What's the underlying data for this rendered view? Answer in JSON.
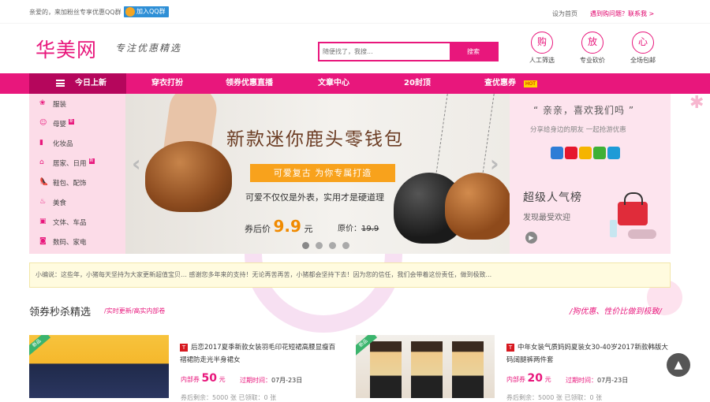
{
  "topbar": {
    "welcome": "亲爱的，来加粉丝专享优惠QQ群",
    "qq_button": "加入QQ群",
    "set_home": "设为首页",
    "contact": "遇到购问题？联系我 >"
  },
  "header": {
    "logo": "华美网",
    "slogan": "专注优惠精选",
    "search_placeholder": "随便找了，我搜...",
    "search_button": "搜索",
    "features": [
      {
        "icon": "购",
        "label": "人工筛选"
      },
      {
        "icon": "放",
        "label": "专业砍价"
      },
      {
        "icon": "心",
        "label": "全场包邮"
      }
    ]
  },
  "nav": {
    "items": [
      "今日上新",
      "穿衣打扮",
      "领券优惠直播",
      "文章中心",
      "20封顶",
      "查优惠券"
    ],
    "hot_badge": "HOT"
  },
  "sidebar": {
    "items": [
      {
        "label": "服装",
        "icon": "dress-icon",
        "glyph": "❀"
      },
      {
        "label": "母婴",
        "icon": "baby-icon",
        "glyph": "☺",
        "tag": "新"
      },
      {
        "label": "化妆品",
        "icon": "lipstick-icon",
        "glyph": "▮"
      },
      {
        "label": "居家、日用",
        "icon": "home-icon",
        "glyph": "⌂",
        "tag": "新"
      },
      {
        "label": "鞋包、配饰",
        "icon": "shoe-icon",
        "glyph": "👠"
      },
      {
        "label": "美食",
        "icon": "food-icon",
        "glyph": "♨"
      },
      {
        "label": "文体、车品",
        "icon": "car-icon",
        "glyph": "▣"
      },
      {
        "label": "数码、家电",
        "icon": "camera-icon",
        "glyph": "◙"
      }
    ]
  },
  "banner": {
    "title": "新款迷你鹿头零钱包",
    "tagline": "可爱复古   为你专属打造",
    "subtitle": "可爱不仅仅是外表，实用才是硬道理",
    "price_label": "券后价",
    "price": "9.9",
    "price_unit": "元",
    "orig_label": "原价：",
    "orig_price": "19.9"
  },
  "right_panel": {
    "greeting": "“ 亲亲，喜欢我们吗 ”",
    "share_text": "分享给身边的朋友 一起抢游优惠",
    "share_colors": [
      "#2e7dd6",
      "#e6162d",
      "#f5b400",
      "#3fb035",
      "#1d9bd7"
    ],
    "hot_title": "超级人气榜",
    "hot_sub": "发现最受欢迎"
  },
  "notice": {
    "text": "小编说：这些年，小猪每天坚持为大家更新超值宝贝… 感谢您多年来的支持！无论再苦再苦，小猪都会坚持下去！因为您的信任，我们会带着这份责任，做到极致..."
  },
  "section": {
    "title": "领券秒杀精选",
    "subtitle": "/实时更新/高实内部卷",
    "right_slogan": "/狗优惠、性价比做到极致/"
  },
  "products": [
    {
      "badge": "新品",
      "title": "后恋2017夏季新款女装羽毛印花短裙高腰显瘦百褶裙防走光半身裙女",
      "coupon_label": "内部券",
      "coupon_value": "50",
      "coupon_unit": "元",
      "expire_label": "过期时间：",
      "expire_date": "07月-23日",
      "row_cut": "券后剩余：5000 张   已领取：0 张"
    },
    {
      "badge": "新品",
      "title": "中年女装气质妈妈夏装女30-40岁2017新款韩版大码阔腿裤两件套",
      "coupon_label": "内部券",
      "coupon_value": "20",
      "coupon_unit": "元",
      "expire_label": "过期时间：",
      "expire_date": "07月-23日",
      "row_cut": "券后剩余：5000 张   已领取：0 张"
    }
  ]
}
